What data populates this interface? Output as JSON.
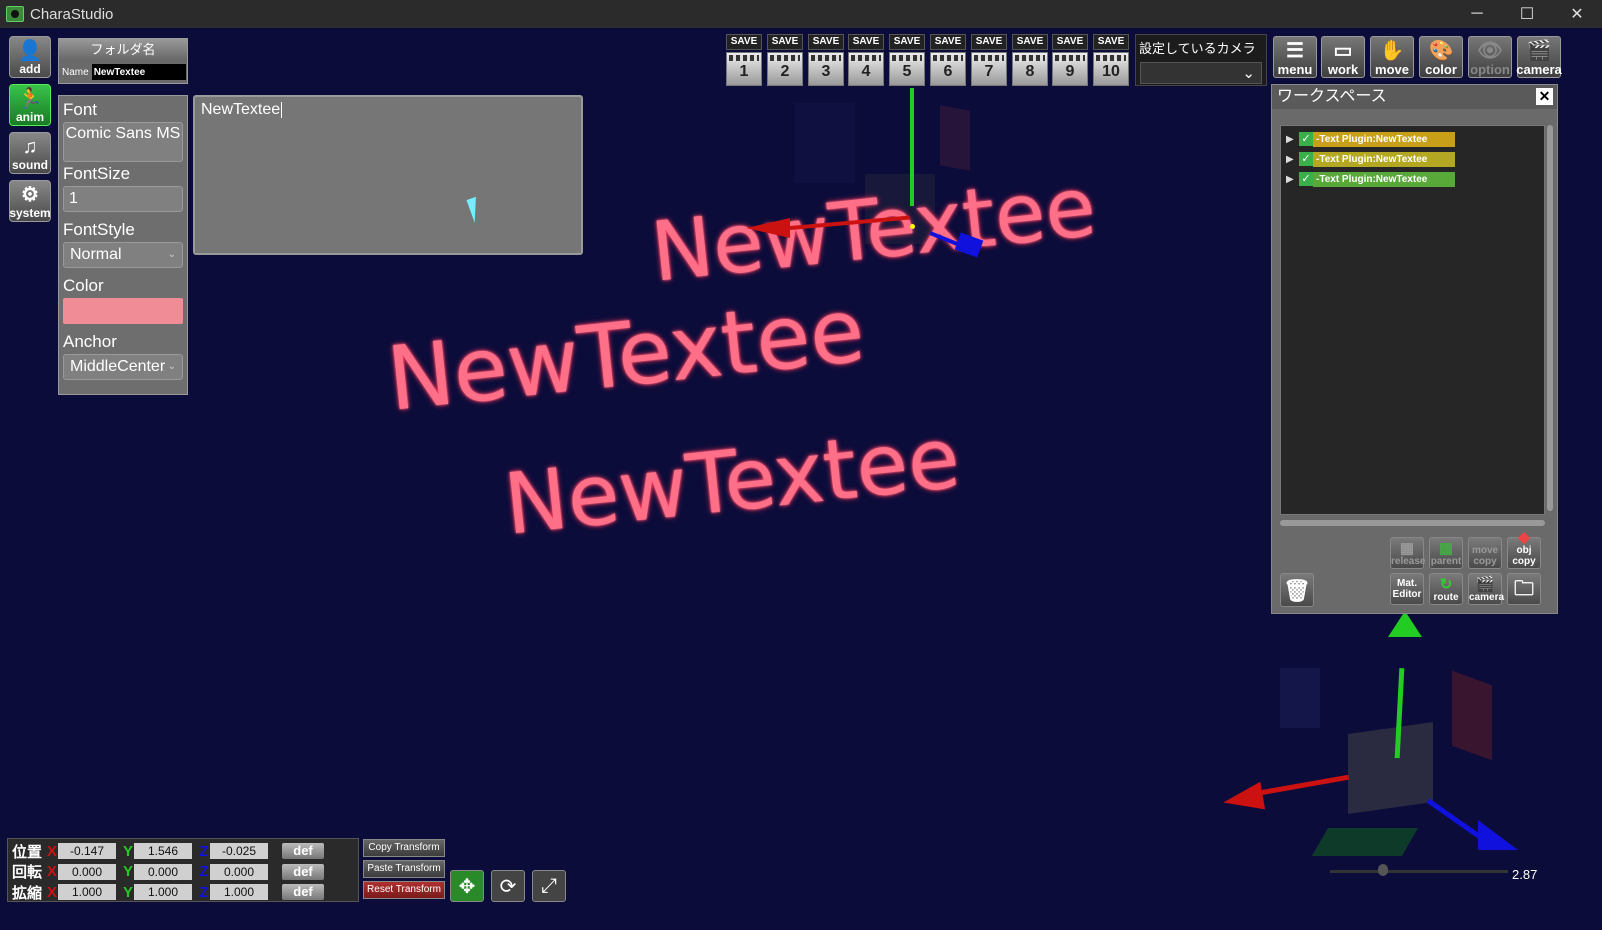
{
  "window": {
    "title": "CharaStudio",
    "min_icon": "─",
    "max_icon": "☐",
    "close_icon": "✕"
  },
  "sidebar": {
    "items": [
      {
        "label": "add",
        "icon": "person-icon"
      },
      {
        "label": "anim",
        "icon": "runner-icon"
      },
      {
        "label": "sound",
        "icon": "music-note-icon"
      },
      {
        "label": "system",
        "icon": "gears-icon"
      }
    ]
  },
  "folder_panel": {
    "header": "フォルダ名",
    "name_label": "Name",
    "name_value": "NewTextee"
  },
  "font_panel": {
    "font_label": "Font",
    "font_value": "Comic Sans MS",
    "fontsize_label": "FontSize",
    "fontsize_value": "1",
    "fontstyle_label": "FontStyle",
    "fontstyle_value": "Normal",
    "color_label": "Color",
    "color_value": "#f08c95",
    "anchor_label": "Anchor",
    "anchor_value": "MiddleCenter"
  },
  "text_editor": {
    "value": "NewTextee"
  },
  "scene_text": [
    "NewTextee",
    "NewTextee",
    "NewTextee"
  ],
  "save_bar": {
    "save_label": "SAVE",
    "slots": [
      "1",
      "2",
      "3",
      "4",
      "5",
      "6",
      "7",
      "8",
      "9",
      "10"
    ]
  },
  "camera": {
    "label": "設定しているカメラ",
    "value": ""
  },
  "toolbar": [
    {
      "label": "menu",
      "icon": "list-icon"
    },
    {
      "label": "work",
      "icon": "window-icon"
    },
    {
      "label": "move",
      "icon": "hand-icon"
    },
    {
      "label": "color",
      "icon": "palette-icon"
    },
    {
      "label": "option",
      "icon": "eye-icon"
    },
    {
      "label": "camera",
      "icon": "clapper-icon"
    }
  ],
  "workspace": {
    "title": "ワークスペース",
    "close": "✕",
    "items": [
      {
        "label": "-Text Plugin:NewTextee",
        "color": "#c8a018"
      },
      {
        "label": "-Text Plugin:NewTextee",
        "color": "#b4a822"
      },
      {
        "label": "-Text Plugin:NewTextee",
        "color": "#58a83a"
      }
    ],
    "buttons": {
      "release": "release",
      "parent": "parent",
      "move_copy": "move copy",
      "obj_copy": "obj copy",
      "mat_editor": "Mat. Editor",
      "route": "route",
      "camera": "camera"
    }
  },
  "transform": {
    "rows": [
      {
        "label": "位置",
        "x": "-0.147",
        "y": "1.546",
        "z": "-0.025"
      },
      {
        "label": "回転",
        "x": "0.000",
        "y": "0.000",
        "z": "0.000"
      },
      {
        "label": "拡縮",
        "x": "1.000",
        "y": "1.000",
        "z": "1.000"
      }
    ],
    "axis_x": "X",
    "axis_y": "Y",
    "axis_z": "Z",
    "def_label": "def",
    "copy": "Copy Transform",
    "paste": "Paste Transform",
    "reset": "Reset Transform"
  },
  "zoom": {
    "value": "2.87"
  },
  "colors": {
    "viewport_bg": "#0b0c3a",
    "text_pink": "#ff6f87",
    "axis_x": "#cc1111",
    "axis_y": "#22cc22",
    "axis_z": "#1111dd"
  }
}
